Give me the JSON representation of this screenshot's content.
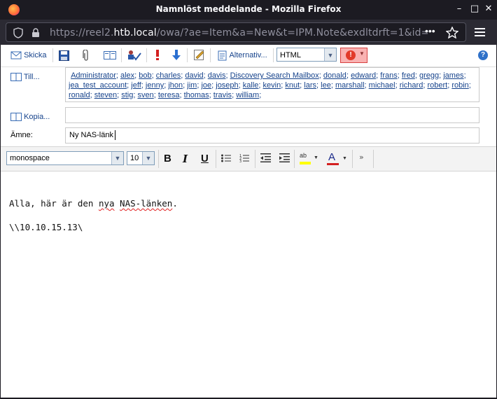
{
  "window": {
    "title": "Namnlöst meddelande - Mozilla Firefox"
  },
  "urlbar": {
    "prefix": "https://reel2.",
    "domain": "htb.local",
    "rest": "/owa/?ae=Item&a=New&t=IPM.Note&exdltdrft=1&id="
  },
  "toolbar": {
    "send_label": "Skicka",
    "options_label": "Alternativ...",
    "format_value": "HTML"
  },
  "fields": {
    "to_label": "Till...",
    "cc_label": "Kopia...",
    "subject_label": "Ämne:",
    "subject_value": "Ny NAS-länk"
  },
  "recipients": [
    "Administrator",
    "alex",
    "bob",
    "charles",
    "david",
    "davis",
    "Discovery Search Mailbox",
    "donald",
    "edward",
    "frans",
    "fred",
    "gregg",
    "james",
    "jea_test_account",
    "jeff",
    "jenny",
    "jhon",
    "jim",
    "joe",
    "joseph",
    "kalle",
    "kevin",
    "knut",
    "lars",
    "lee",
    "marshall",
    "michael",
    "richard",
    "robert",
    "robin",
    "ronald",
    "steven",
    "stig",
    "sven",
    "teresa",
    "thomas",
    "travis",
    "william"
  ],
  "format": {
    "font_value": "monospace",
    "size_value": "10"
  },
  "body": {
    "line1": "Alla, här är den nya NAS-länken.",
    "line2": "\\\\10.10.15.13\\"
  },
  "colors": {
    "link": "#15428b",
    "importance_bg": "#f9b2b2"
  }
}
